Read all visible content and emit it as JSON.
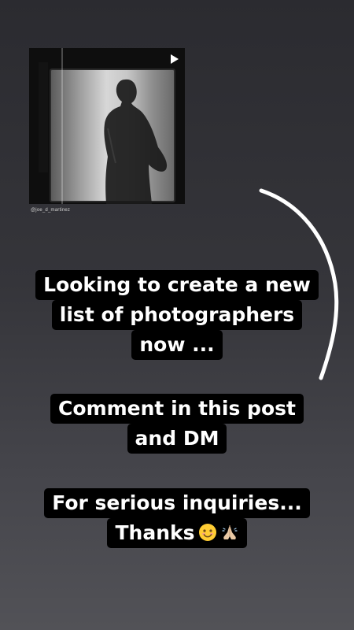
{
  "story": {
    "media": {
      "handle": "@joe_d_martinez",
      "play_icon": "play-icon"
    },
    "texts": {
      "block1": [
        "Looking to create a new",
        "list of photographers",
        "now ..."
      ],
      "block2": [
        "Comment in this post",
        "and DM"
      ],
      "block3_line1": "For serious inquiries...",
      "block3_line2": "Thanks"
    },
    "emojis": [
      "smiling-face-icon",
      "folded-hands-icon"
    ],
    "colors": {
      "text": "#ffffff",
      "text_background": "#000000",
      "background_top": "#2b2b30",
      "background_bottom": "#525257",
      "swoosh": "#ffffff"
    }
  }
}
